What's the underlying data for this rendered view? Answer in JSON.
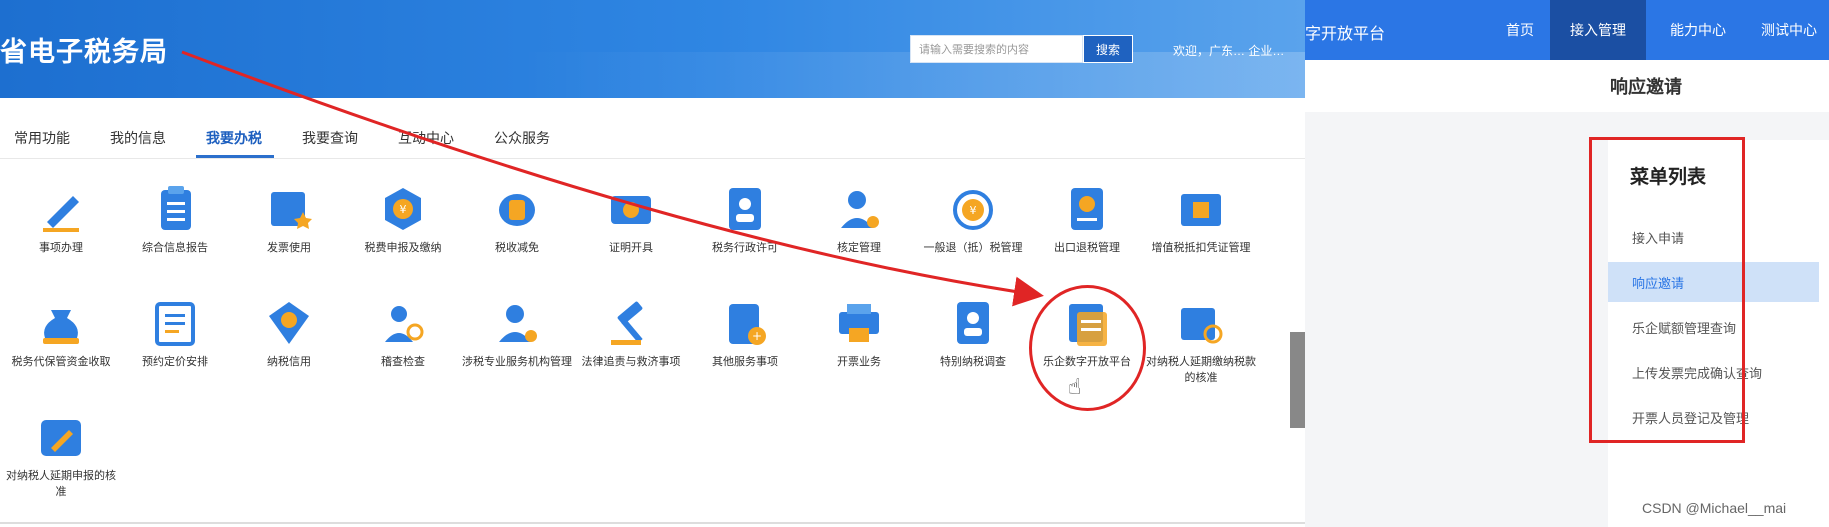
{
  "left": {
    "bureau_title": "省电子税务局",
    "search_placeholder": "请输入需要搜索的内容",
    "search_button": "搜索",
    "welcome": "欢迎，广东…  企业…",
    "tabs": [
      "常用功能",
      "我的信息",
      "我要办税",
      "我要查询",
      "互动中心",
      "公众服务"
    ],
    "active_tab": "我要办税",
    "items": [
      {
        "label": "事项办理",
        "icon": "pencil-icon"
      },
      {
        "label": "综合信息报告",
        "icon": "clipboard-icon"
      },
      {
        "label": "发票使用",
        "icon": "invoice-star-icon"
      },
      {
        "label": "税费申报及缴纳",
        "icon": "tax-hexagon-icon"
      },
      {
        "label": "税收减免",
        "icon": "coin-stack-icon"
      },
      {
        "label": "证明开具",
        "icon": "ticket-icon"
      },
      {
        "label": "税务行政许可",
        "icon": "person-card-icon"
      },
      {
        "label": "核定管理",
        "icon": "person-gear-icon"
      },
      {
        "label": "一般退（抵）税管理",
        "icon": "yuan-refresh-icon"
      },
      {
        "label": "出口退税管理",
        "icon": "book-yuan-icon"
      },
      {
        "label": "增值税抵扣凭证管理",
        "icon": "vat-ticket-icon"
      },
      {
        "label": "税务代保管资金收取",
        "icon": "money-bag-icon"
      },
      {
        "label": "预约定价安排",
        "icon": "document-list-icon"
      },
      {
        "label": "纳税信用",
        "icon": "diamond-check-icon"
      },
      {
        "label": "稽查检查",
        "icon": "person-search-icon"
      },
      {
        "label": "涉税专业服务机构管理",
        "icon": "person-gear-icon"
      },
      {
        "label": "法律追责与救济事项",
        "icon": "gavel-icon"
      },
      {
        "label": "其他服务事项",
        "icon": "clipboard-add-icon"
      },
      {
        "label": "开票业务",
        "icon": "printer-icon"
      },
      {
        "label": "特别纳税调查",
        "icon": "person-card-icon"
      },
      {
        "label": "乐企数字开放平台",
        "icon": "digital-platform-icon"
      },
      {
        "label": "对纳税人延期缴纳税款的核准",
        "icon": "yuan-search-icon"
      },
      {
        "label": "对纳税人延期申报的核准",
        "icon": "pencil-badge-icon"
      }
    ]
  },
  "right": {
    "platform_title": "字开放平台",
    "nav": [
      "首页",
      "接入管理",
      "能力中心",
      "测试中心"
    ],
    "active_nav": "接入管理",
    "section_title": "响应邀请",
    "menu_title": "菜单列表",
    "menu_items": [
      "接入申请",
      "响应邀请",
      "乐企赋额管理查询",
      "上传发票完成确认查询",
      "开票人员登记及管理"
    ],
    "active_menu": "响应邀请",
    "watermark": "CSDN @Michael__mai"
  },
  "colors": {
    "primary": "#2b76e5",
    "highlight": "#cfe1f8",
    "annotation_red": "#e02525"
  }
}
